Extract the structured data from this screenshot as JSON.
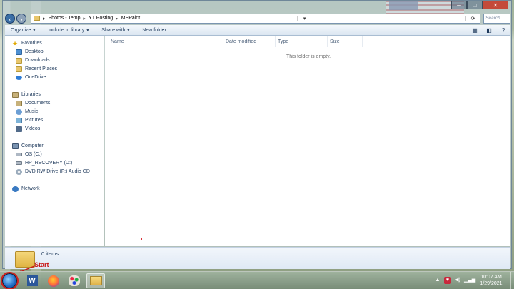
{
  "window": {
    "caption_buttons": {
      "minimize": "─",
      "maximize": "□",
      "close": "✕"
    }
  },
  "address": {
    "crumbs": [
      "Photos - Temp",
      "YT Posting",
      "MSPaint"
    ],
    "separator": "▸",
    "search_placeholder": "Search..."
  },
  "toolbar": {
    "organize": "Organize",
    "include_in_library": "Include in library",
    "share_with": "Share with",
    "new_folder": "New folder"
  },
  "nav": {
    "favorites": {
      "label": "Favorites",
      "items": [
        "Desktop",
        "Downloads",
        "Recent Places",
        "OneDrive"
      ]
    },
    "libraries": {
      "label": "Libraries",
      "items": [
        "Documents",
        "Music",
        "Pictures",
        "Videos"
      ]
    },
    "computer": {
      "label": "Computer",
      "items": [
        "OS (C:)",
        "HP_RECOVERY (D:)",
        "DVD RW Drive (F:) Audio CD"
      ]
    },
    "network": {
      "label": "Network"
    }
  },
  "content": {
    "columns": [
      "Name",
      "Date modified",
      "Type",
      "Size"
    ],
    "empty_message": "This folder is empty."
  },
  "details": {
    "item_count": "0 items"
  },
  "annotation": {
    "label": "Start",
    "color": "#c81414"
  },
  "taskbar": {
    "apps": [
      {
        "name": "Microsoft Word",
        "icon": "word-icon",
        "glyph": "W"
      },
      {
        "name": "Firefox",
        "icon": "firefox-icon"
      },
      {
        "name": "Paint",
        "icon": "paint-icon"
      },
      {
        "name": "Windows Explorer",
        "icon": "explorer-icon"
      }
    ],
    "time": "10:07 AM",
    "date": "1/29/2021"
  },
  "colors": {
    "toolbar_text": "#1e395b",
    "start_orb": "#1f6ac4",
    "highlight_ring": "#d02020"
  }
}
